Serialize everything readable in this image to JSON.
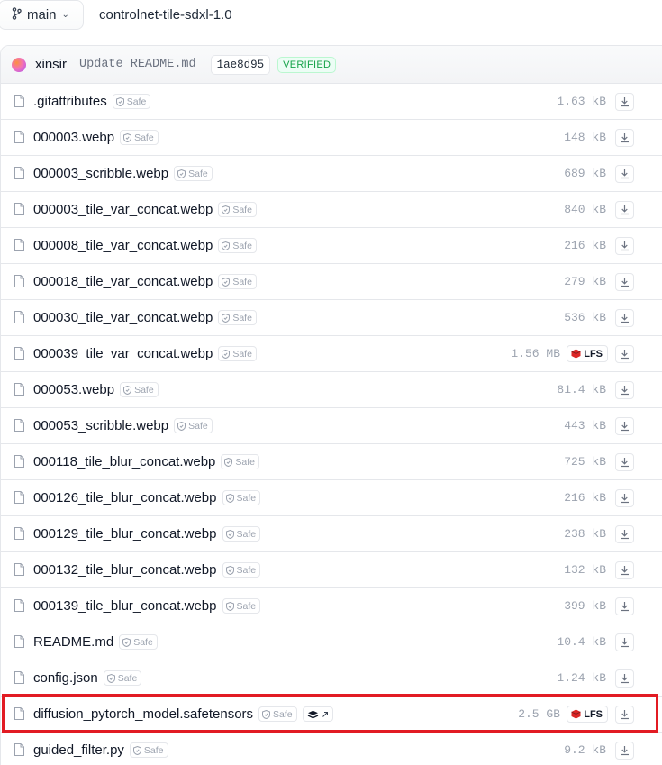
{
  "branch": {
    "label": "main",
    "icon": "git-branch-icon"
  },
  "repo_path": "controlnet-tile-sdxl-1.0",
  "commit": {
    "author": "xinsir",
    "message": "Update README.md",
    "sha": "1ae8d95",
    "verified": "VERIFIED"
  },
  "safe_label": "Safe",
  "lfs_label": "LFS",
  "highlight_color": "#e21b23",
  "files": [
    {
      "name": ".gitattributes",
      "size": "1.63 kB",
      "lfs": false
    },
    {
      "name": "000003.webp",
      "size": "148 kB",
      "lfs": false
    },
    {
      "name": "000003_scribble.webp",
      "size": "689 kB",
      "lfs": false
    },
    {
      "name": "000003_tile_var_concat.webp",
      "size": "840 kB",
      "lfs": false
    },
    {
      "name": "000008_tile_var_concat.webp",
      "size": "216 kB",
      "lfs": false
    },
    {
      "name": "000018_tile_var_concat.webp",
      "size": "279 kB",
      "lfs": false
    },
    {
      "name": "000030_tile_var_concat.webp",
      "size": "536 kB",
      "lfs": false
    },
    {
      "name": "000039_tile_var_concat.webp",
      "size": "1.56 MB",
      "lfs": true
    },
    {
      "name": "000053.webp",
      "size": "81.4 kB",
      "lfs": false
    },
    {
      "name": "000053_scribble.webp",
      "size": "443 kB",
      "lfs": false
    },
    {
      "name": "000118_tile_blur_concat.webp",
      "size": "725 kB",
      "lfs": false
    },
    {
      "name": "000126_tile_blur_concat.webp",
      "size": "216 kB",
      "lfs": false
    },
    {
      "name": "000129_tile_blur_concat.webp",
      "size": "238 kB",
      "lfs": false
    },
    {
      "name": "000132_tile_blur_concat.webp",
      "size": "132 kB",
      "lfs": false
    },
    {
      "name": "000139_tile_blur_concat.webp",
      "size": "399 kB",
      "lfs": false
    },
    {
      "name": "README.md",
      "size": "10.4 kB",
      "lfs": false
    },
    {
      "name": "config.json",
      "size": "1.24 kB",
      "lfs": false
    },
    {
      "name": "diffusion_pytorch_model.safetensors",
      "size": "2.5 GB",
      "lfs": true,
      "viewer_badge": true,
      "highlighted": true
    },
    {
      "name": "guided_filter.py",
      "size": "9.2 kB",
      "lfs": false
    }
  ]
}
